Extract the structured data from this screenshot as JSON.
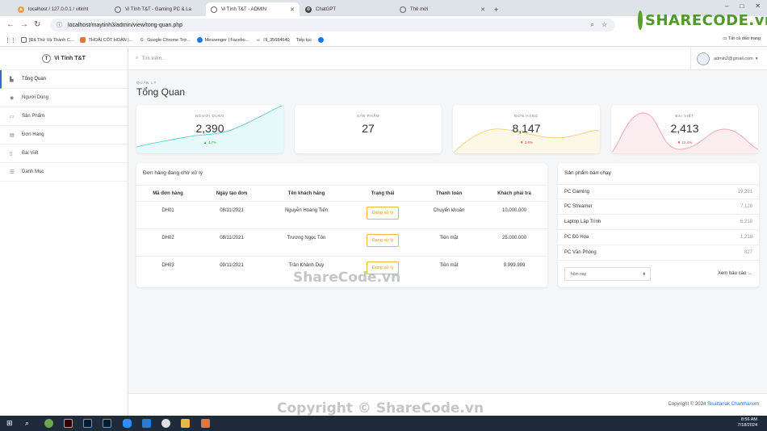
{
  "browser": {
    "tabs": [
      {
        "title": "localhost / 127.0.0.1 / vitinht",
        "active": false
      },
      {
        "title": "Vi Tính T&T - Gaming PC & La",
        "active": false
      },
      {
        "title": "Vi Tính T&T - ADMIN",
        "active": true
      },
      {
        "title": "ChatGPT",
        "active": false
      },
      {
        "title": "Thẻ mới",
        "active": false
      }
    ],
    "url": "localhost/maytinh3/admin/view/tong-quan.php",
    "bookmarks": [
      "[Đã Thử Và Thành C...",
      "THOẢI CỐT HOÀN |...",
      "Google Chrome Trợ...",
      "Messenger | Facebo...",
      "i'll_35684640",
      "Tiếp tục"
    ],
    "all_bookmarks": "Tất cả dấu trang"
  },
  "watermark": {
    "logo_text": "SHARECODE.vn",
    "mid": "ShareCode.vn",
    "bottom": "Copyright © ShareCode.vn"
  },
  "sidebar": {
    "brand": "Vi Tính T&T",
    "items": [
      {
        "label": "Tổng Quan",
        "icon": "chart-icon",
        "active": true
      },
      {
        "label": "Người Dùng",
        "icon": "user-icon",
        "active": false
      },
      {
        "label": "Sản Phẩm",
        "icon": "monitor-icon",
        "active": false
      },
      {
        "label": "Đơn Hàng",
        "icon": "receipt-icon",
        "active": false
      },
      {
        "label": "Bài Viết",
        "icon": "document-icon",
        "active": false
      },
      {
        "label": "Danh Mục",
        "icon": "list-icon",
        "active": false
      }
    ]
  },
  "header": {
    "search_placeholder": "Tìm kiếm...",
    "user_email": "admin2@gmail.com"
  },
  "page": {
    "overline": "QUẢN LÝ",
    "title": "Tổng Quan"
  },
  "stats": [
    {
      "label": "NGƯỜI DÙNG",
      "value": "2,390",
      "change": "4.7%",
      "direction": "up",
      "color": "#5fd0d6"
    },
    {
      "label": "SẢN PHẨM",
      "value": "27",
      "change": "",
      "direction": "none",
      "color": ""
    },
    {
      "label": "ĐƠN HÀNG",
      "value": "8,147",
      "change": "3.8%",
      "direction": "down",
      "color": "#f2d27a"
    },
    {
      "label": "BÀI VIẾT",
      "value": "2,413",
      "change": "12.4%",
      "direction": "down",
      "color": "#f2a8b2"
    }
  ],
  "orders": {
    "title": "Đơn hàng đang chờ xử lý",
    "columns": [
      "Mã đơn hàng",
      "Ngày tạo đơn",
      "Tên khách hàng",
      "Trạng thái",
      "Thanh toán",
      "Khách phải trả"
    ],
    "rows": [
      {
        "id": "DH01",
        "date": "08/11/2021",
        "customer": "Nguyễn Hoàng Tiến",
        "status": "Đang xử lý",
        "payment": "Chuyển khoản",
        "total": "10.000.000"
      },
      {
        "id": "DH02",
        "date": "08/11/2021",
        "customer": "Trương Ngọc Tôn",
        "status": "Đang xử lý",
        "payment": "Tiền mặt",
        "total": "25.000.000"
      },
      {
        "id": "DH03",
        "date": "09/11/2021",
        "customer": "Trần Khánh Duy",
        "status": "Đang xử lý",
        "payment": "Tiền mặt",
        "total": "9.999.999"
      }
    ]
  },
  "bestsellers": {
    "title": "Sản phẩm bán chạy",
    "items": [
      {
        "name": "PC Gaming",
        "count": "19,291"
      },
      {
        "name": "PC Streamer",
        "count": "7,128"
      },
      {
        "name": "Laptop Lập Trình",
        "count": "6,218"
      },
      {
        "name": "PC Đồ Họa",
        "count": "1,218"
      },
      {
        "name": "PC Văn Phòng",
        "count": "827"
      }
    ],
    "filter_selected": "hôm nay",
    "view_report": "Xem báo cáo"
  },
  "footer": {
    "prefix": "Copyright © 2024",
    "author": "Sisattanak Chanthanom"
  },
  "taskbar": {
    "time": "8:56 AM",
    "date": "7/18/2024"
  }
}
